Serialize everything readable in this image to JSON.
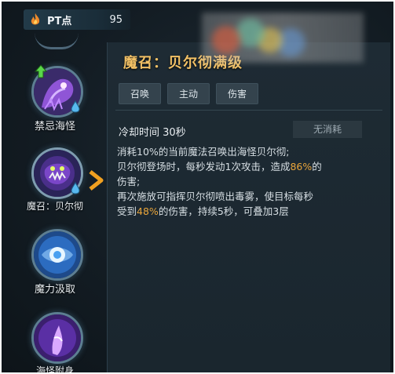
{
  "pt": {
    "label": "PT点",
    "value": "95",
    "icon": "flame-icon"
  },
  "skills": [
    {
      "label": "禁忌海怪",
      "icon": "sea-monster-icon",
      "upgradable": true,
      "badge": "water-drop-icon"
    },
    {
      "label": "魔召：贝尔彻",
      "icon": "belch-summon-icon",
      "selected": true,
      "badge": "water-drop-icon"
    },
    {
      "label": "魔力汲取",
      "icon": "mana-drain-icon"
    },
    {
      "label": "海怪附身",
      "icon": "sea-possession-icon"
    }
  ],
  "detail": {
    "title": "魔召：贝尔彻满级",
    "tags": [
      "召唤",
      "主动",
      "伤害"
    ],
    "cooldown": "冷却时间 30秒",
    "cost": "无消耗",
    "desc": {
      "line1": "消耗10%的当前魔法召唤出海怪贝尔彻;",
      "line2a": "贝尔彻登场时，每秒发动1次攻击，造成",
      "line2hl": "86%",
      "line2b": "的",
      "line3": "伤害;",
      "line4": "再次施放可指挥贝尔彻喷出毒雾，使目标每秒",
      "line5a": "受到",
      "line5hl": "48%",
      "line5b": "的伤害，持续5秒，可叠加3层"
    }
  },
  "colors": {
    "title": "#f2c166",
    "highlight": "#e9a53b",
    "select_arrow": "#f0a020"
  }
}
